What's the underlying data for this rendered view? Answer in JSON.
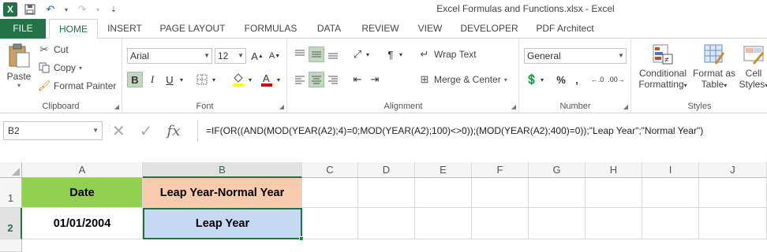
{
  "window": {
    "title": "Excel Formulas and Functions.xlsx - Excel"
  },
  "qat": {
    "app_icon": "X",
    "save_icon": "save-icon",
    "undo_icon": "undo-icon",
    "redo_icon": "redo-icon"
  },
  "tabs": [
    {
      "label": "FILE"
    },
    {
      "label": "HOME"
    },
    {
      "label": "INSERT"
    },
    {
      "label": "PAGE LAYOUT"
    },
    {
      "label": "FORMULAS"
    },
    {
      "label": "DATA"
    },
    {
      "label": "REVIEW"
    },
    {
      "label": "VIEW"
    },
    {
      "label": "DEVELOPER"
    },
    {
      "label": "PDF Architect"
    }
  ],
  "ribbon": {
    "clipboard": {
      "label": "Clipboard",
      "paste": "Paste",
      "cut": "Cut",
      "copy": "Copy",
      "format_painter": "Format Painter"
    },
    "font": {
      "label": "Font",
      "font_name": "Arial",
      "font_size": "12",
      "bold": "B",
      "italic": "I",
      "underline": "U"
    },
    "alignment": {
      "label": "Alignment",
      "wrap_text": "Wrap Text",
      "merge_center": "Merge & Center"
    },
    "number": {
      "label": "Number",
      "format": "General",
      "percent": "%",
      "comma": ","
    },
    "styles": {
      "label": "Styles",
      "conditional_1": "Conditional",
      "conditional_2": "Formatting",
      "format_as_1": "Format as",
      "format_as_2": "Table",
      "cell_styles_1": "Cell",
      "cell_styles_2": "Styles"
    }
  },
  "formula_bar": {
    "name_box": "B2",
    "formula": "=IF(OR((AND(MOD(YEAR(A2);4)=0;MOD(YEAR(A2);100)<>0));(MOD(YEAR(A2);400)=0));\"Leap Year\";\"Normal Year\")"
  },
  "sheet": {
    "columns": [
      "A",
      "B",
      "C",
      "D",
      "E",
      "F",
      "G",
      "H",
      "I",
      "J"
    ],
    "rows": [
      "1",
      "2"
    ],
    "cells": {
      "A1": "Date",
      "B1": "Leap Year-Normal Year",
      "A2": "01/01/2004",
      "B2": "Leap Year"
    },
    "selected_cell": "B2"
  },
  "colors": {
    "accent": "#217346",
    "a1_fill": "#92d050",
    "b1_fill": "#f8cbad",
    "b2_fill": "#c5d9f1"
  }
}
